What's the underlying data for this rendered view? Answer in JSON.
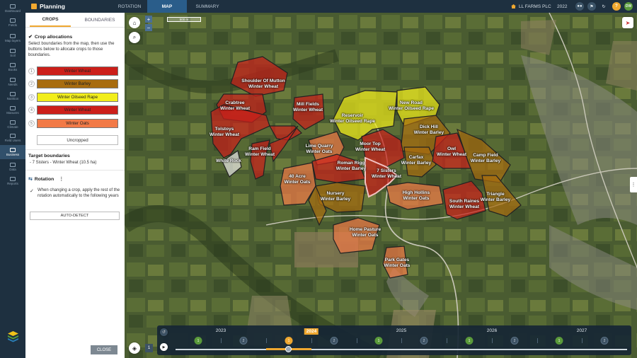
{
  "app": {
    "title": "Planning"
  },
  "top_tabs": [
    {
      "label": "ROTATION"
    },
    {
      "label": "MAP"
    },
    {
      "label": "SUMMARY"
    }
  ],
  "farm_name": "LL FARMS PLC",
  "year": "2022",
  "user_initials": "DW",
  "help_label": "?",
  "nav_items": [
    {
      "label": "Dashboard"
    },
    {
      "label": "Fields"
    },
    {
      "label": "Map layers"
    },
    {
      "label": "Soil"
    },
    {
      "label": "Books"
    },
    {
      "label": "Needs"
    },
    {
      "label": "Nutrition"
    },
    {
      "label": "Manures"
    },
    {
      "label": "Climate"
    },
    {
      "label": "Field Users"
    },
    {
      "label": "Business"
    },
    {
      "label": "Data"
    },
    {
      "label": "Reports"
    }
  ],
  "panel": {
    "tabs": [
      {
        "label": "CROPS"
      },
      {
        "label": "BOUNDARIES"
      }
    ],
    "crop_alloc_title": "Crop allocations",
    "crop_alloc_desc": "Select boundaries from the map, then use the buttons below to allocate crops to those boundaries.",
    "crops": [
      {
        "num": "1",
        "label": "Winter Wheat",
        "color": "#cc1f1a"
      },
      {
        "num": "2",
        "label": "Winter Barley",
        "color": "#a86c0e"
      },
      {
        "num": "3",
        "label": "Winter Oilseed Rape",
        "color": "#f2ee1a"
      },
      {
        "num": "4",
        "label": "Winter Wheat",
        "color": "#cc1f1a"
      },
      {
        "num": "5",
        "label": "Winter Oats",
        "color": "#f27a47"
      }
    ],
    "uncropped_label": "Uncropped",
    "target_title": "Target boundaries",
    "target_item": "- 7 Sisters - Winter Wheat (10.5 ha)",
    "rotation_title": "Rotation",
    "rotation_desc": "When changing a crop, apply the rest of the rotation automatically to the following years",
    "auto_detect_label": "AUTO-DETECT",
    "close_label": "CLOSE"
  },
  "map": {
    "scale_label": "500 m",
    "fields": [
      {
        "label": "Shoulder Of Mutton\nWinter Wheat"
      },
      {
        "label": "Crabtree\nWinter Wheat"
      },
      {
        "label": "Mill Fields\nWinter Wheat"
      },
      {
        "label": "Tolstoys\nWinter Wheat"
      },
      {
        "label": "Ram Field\nWinter Wheat"
      },
      {
        "label": "White Rock"
      },
      {
        "label": "Reservoir\nWinter Oilseed Rape"
      },
      {
        "label": "New Road\nWinter Oilseed Rape"
      },
      {
        "label": "Dick Hill\nWinter Barley"
      },
      {
        "label": "Moor Top\nWinter Wheat"
      },
      {
        "label": "Lime Quarry\nWinter Oats"
      },
      {
        "label": "Carfax\nWinter Barley"
      },
      {
        "label": "Owl\nWinter Wheat"
      },
      {
        "label": "Camp Field\nWinter Barley"
      },
      {
        "label": "Roman Rigg\nWinter Barley"
      },
      {
        "label": "7 Sisters\nWinter Wheat"
      },
      {
        "label": "40 Acre\nWinter Oats"
      },
      {
        "label": "Nursery\nWinter Barley"
      },
      {
        "label": "High Hollins\nWinter Oats"
      },
      {
        "label": "South Raines\nWinter Wheat"
      },
      {
        "label": "Triangle\nWinter Barley"
      },
      {
        "label": "Home Pasture\nWinter Oats"
      },
      {
        "label": "Park Gates\nWinter Oats"
      }
    ]
  },
  "timeline": {
    "years": [
      {
        "label": "2023",
        "current": false
      },
      {
        "label": "2024",
        "current": true
      },
      {
        "label": "2025",
        "current": false
      },
      {
        "label": "2026",
        "current": false
      },
      {
        "label": "2027",
        "current": false
      }
    ],
    "markers": [
      {
        "label": "1",
        "style": "g"
      },
      {
        "label": "2",
        "style": "n"
      },
      {
        "label": "1",
        "style": "o"
      },
      {
        "label": "2",
        "style": "n"
      },
      {
        "label": "1",
        "style": "g"
      },
      {
        "label": "2",
        "style": "n"
      },
      {
        "label": "1",
        "style": "g"
      },
      {
        "label": "2",
        "style": "n"
      },
      {
        "label": "1",
        "style": "g"
      },
      {
        "label": "2",
        "style": "n"
      }
    ],
    "layer_count": "1"
  },
  "colors": {
    "winter_wheat": "#cc1f1a",
    "winter_barley": "#a86c0e",
    "winter_oilseed_rape": "#f2ee1a",
    "winter_oats": "#f27a47",
    "accent": "#f0a830",
    "nav_bg": "#1e3040"
  }
}
